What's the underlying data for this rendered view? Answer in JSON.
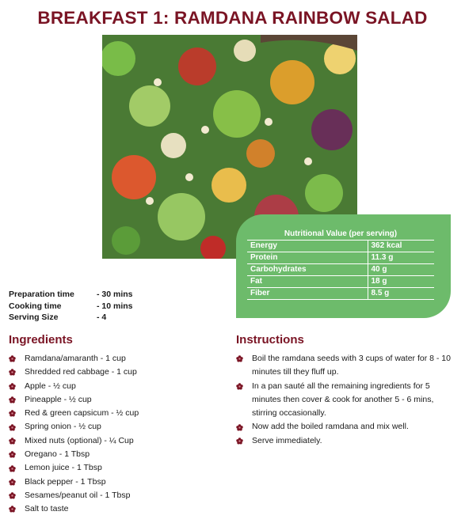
{
  "title": "BREAKFAST 1: RAMDANA RAINBOW SALAD",
  "photo_alt": "Rainbow salad",
  "nutrition": {
    "title": "Nutritional Value (per serving)",
    "rows": [
      {
        "label": "Energy",
        "value": "362 kcal"
      },
      {
        "label": "Protein",
        "value": "11.3 g"
      },
      {
        "label": "Carbohydrates",
        "value": "40 g"
      },
      {
        "label": "Fat",
        "value": "18 g"
      },
      {
        "label": "Fiber",
        "value": "8.5 g"
      }
    ]
  },
  "prep": [
    {
      "label": "Preparation time",
      "value": "- 30 mins"
    },
    {
      "label": "Cooking time",
      "value": "- 10 mins"
    },
    {
      "label": "Serving Size",
      "value": "- 4"
    }
  ],
  "ingredients": {
    "heading": "Ingredients",
    "items": [
      "Ramdana/amaranth - 1 cup",
      "Shredded red cabbage - 1 cup",
      "Apple - ½ cup",
      "Pineapple - ½ cup",
      "Red & green capsicum -  ½ cup",
      "Spring onion - ½ cup",
      "Mixed nuts (optional) - ¼ Cup",
      "Oregano - 1 Tbsp",
      "Lemon juice - 1 Tbsp",
      "Black pepper - 1 Tbsp",
      "Sesames/peanut oil - 1 Tbsp",
      "Salt to taste"
    ]
  },
  "instructions": {
    "heading": "Instructions",
    "items": [
      "Boil the ramdana seeds with 3 cups of water for 8 - 10 minutes till they fluff up.",
      "In a pan sauté all the remaining ingredients for 5 minutes then cover & cook for another 5 - 6 mins, stirring occasionally.",
      "Now add the boiled ramdana and mix well.",
      "Serve immediately."
    ]
  },
  "colors": {
    "accent": "#7a1424",
    "nutrition_bg": "#6dbb6b"
  },
  "icons": {
    "bullet": "flower-bullet-icon"
  }
}
